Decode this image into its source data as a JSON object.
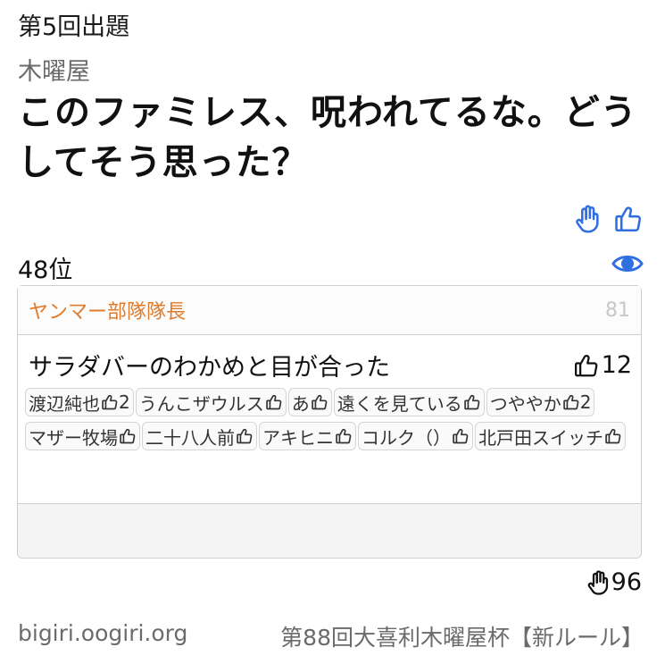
{
  "header": {
    "round_label": "第5回出題",
    "host": "木曜屋",
    "question": "このファミレス、呪われてるな。どうしてそう思った？"
  },
  "rank": "48位",
  "answer_card": {
    "author": "ヤンマー部隊隊長",
    "number": "81",
    "answer_text": "サラダバーのわかめと目が合った",
    "likes": "12",
    "voters": [
      {
        "name": "渡辺純也",
        "count": "2"
      },
      {
        "name": "うんこザウルス",
        "count": ""
      },
      {
        "name": "あ",
        "count": ""
      },
      {
        "name": "遠くを見ている",
        "count": ""
      },
      {
        "name": "つややか",
        "count": "2"
      },
      {
        "name": "マザー牧場",
        "count": ""
      },
      {
        "name": "二十八人前",
        "count": ""
      },
      {
        "name": "アキヒニ",
        "count": ""
      },
      {
        "name": "コルク（）",
        "count": ""
      },
      {
        "name": "北戸田スイッチ",
        "count": ""
      }
    ]
  },
  "hand_count": "96",
  "footer": {
    "site": "bigiri.oogiri.org",
    "tournament": "第88回大喜利木曜屋杯【新ルール】"
  },
  "colors": {
    "accent_blue": "#2f6fe0",
    "author_orange": "#e07b2a"
  },
  "icons": [
    "hand-icon",
    "thumbs-up-icon",
    "eye-icon"
  ]
}
